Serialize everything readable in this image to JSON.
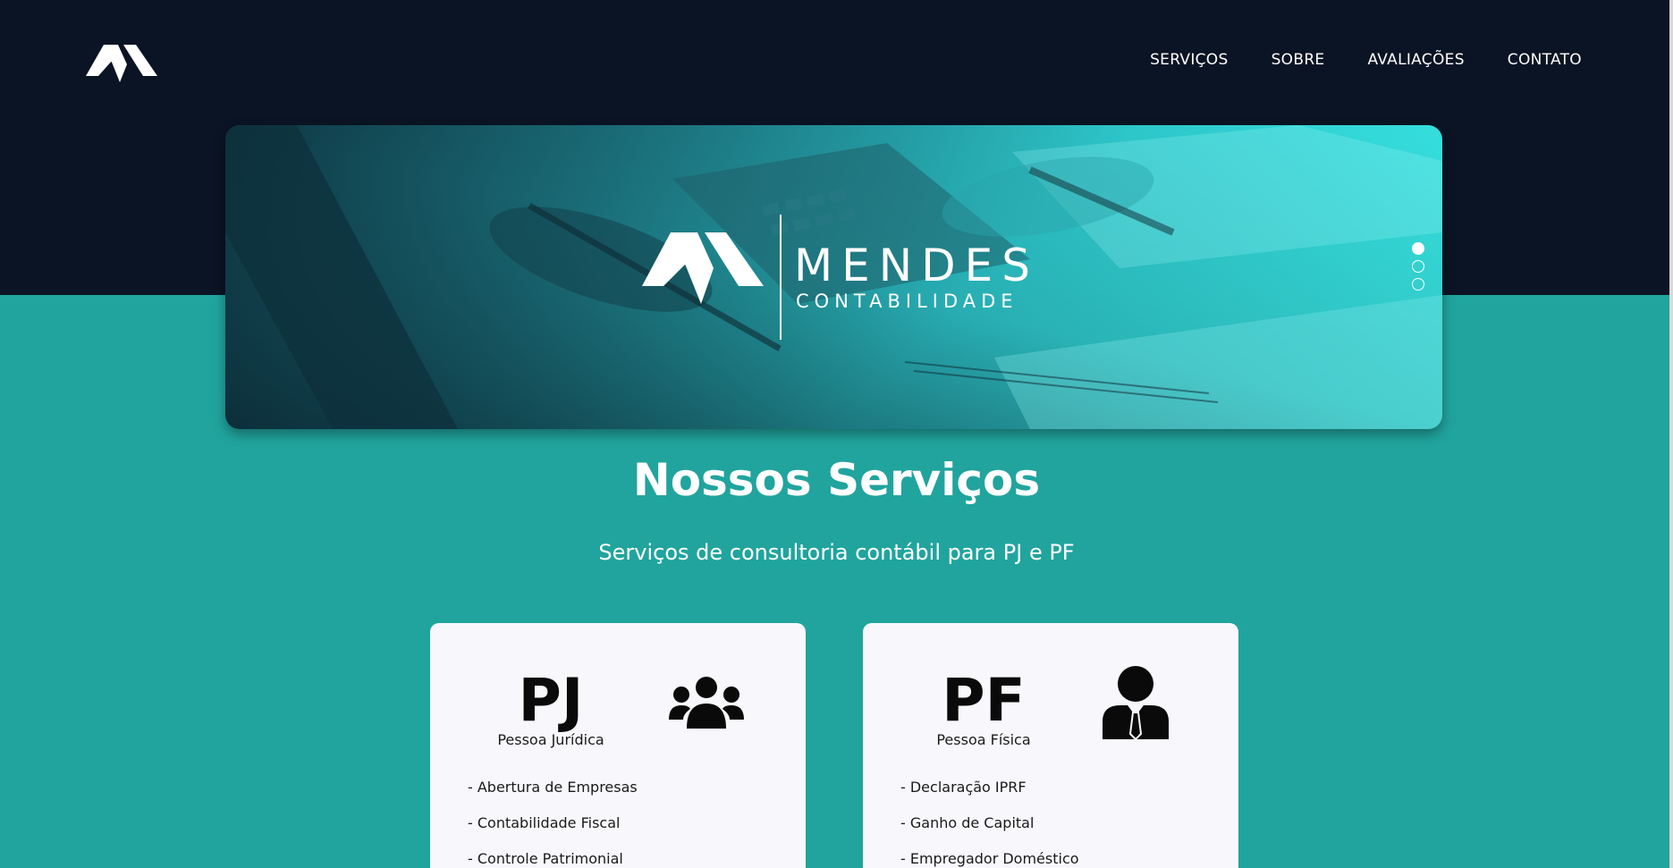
{
  "nav": {
    "items": [
      "SERVIÇOS",
      "SOBRE",
      "AVALIAÇÕES",
      "CONTATO"
    ]
  },
  "banner": {
    "brand_name": "MENDES",
    "brand_sub": "CONTABILIDADE",
    "slides": 3,
    "active_slide": 1
  },
  "services": {
    "title": "Nossos Serviços",
    "subtitle": "Serviços de consultoria contábil para PJ e PF",
    "cards": [
      {
        "code": "PJ",
        "type": "Pessoa Jurídica",
        "icon": "users-group-icon",
        "items": [
          "- Abertura de Empresas",
          "- Contabilidade Fiscal",
          "- Controle Patrimonial"
        ]
      },
      {
        "code": "PF",
        "type": "Pessoa Física",
        "icon": "user-suit-icon",
        "items": [
          "- Declaração IPRF",
          "- Ganho de Capital",
          "- Empregador Doméstico"
        ]
      }
    ]
  },
  "colors": {
    "header_bg": "#0b1424",
    "page_bg": "#21a49e",
    "banner_accent": "#3bece8",
    "card_bg": "#f8f8fc"
  }
}
